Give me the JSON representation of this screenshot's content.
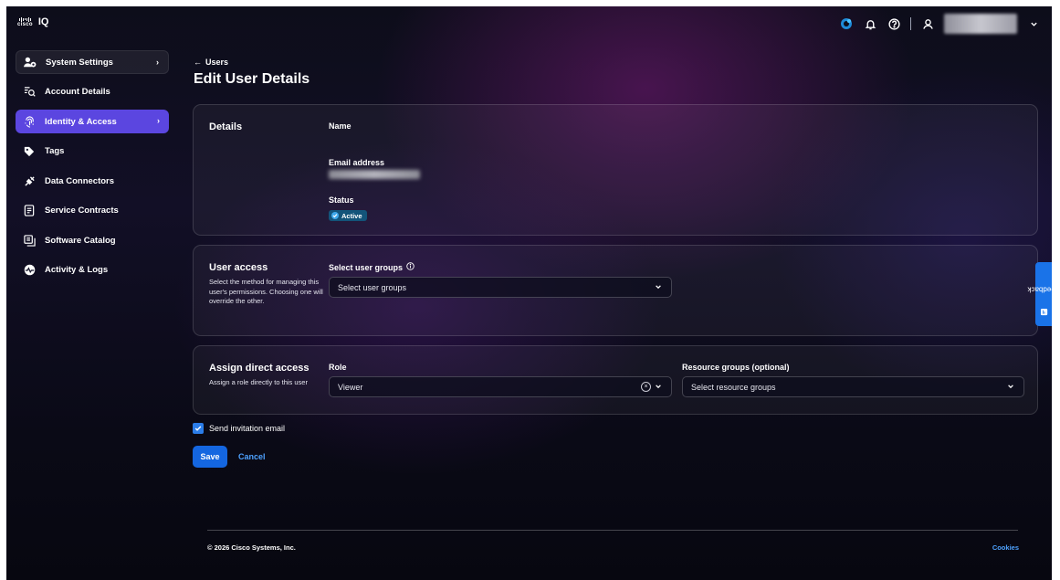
{
  "brand": {
    "name": "IQ",
    "wordmark": "cisco"
  },
  "topbar": {
    "icons": [
      "webex-icon",
      "bell-icon",
      "help-icon",
      "user-icon",
      "chevron-down-icon"
    ]
  },
  "sidebar": {
    "items": [
      {
        "label": "System Settings",
        "icon": "users-gear-icon"
      },
      {
        "label": "Account Details",
        "icon": "list-search-icon"
      },
      {
        "label": "Identity & Access",
        "icon": "fingerprint-icon",
        "active": true
      },
      {
        "label": "Tags",
        "icon": "tag-icon"
      },
      {
        "label": "Data Connectors",
        "icon": "plug-icon"
      },
      {
        "label": "Service Contracts",
        "icon": "contract-icon"
      },
      {
        "label": "Software Catalog",
        "icon": "catalog-icon"
      },
      {
        "label": "Activity & Logs",
        "icon": "activity-icon"
      }
    ]
  },
  "breadcrumb": {
    "arrow": "←",
    "label": "Users"
  },
  "page_title": "Edit User Details",
  "details": {
    "title": "Details",
    "name_label": "Name",
    "email_label": "Email address",
    "status_label": "Status",
    "status_value": "Active"
  },
  "user_access": {
    "title": "User access",
    "description": "Select the method for managing this user's permissions. Choosing one will override the other.",
    "groups_label": "Select user groups",
    "groups_placeholder": "Select user groups"
  },
  "direct_access": {
    "title": "Assign direct access",
    "description": "Assign a role directly to this user",
    "role_label": "Role",
    "role_value": "Viewer",
    "resource_label": "Resource groups (optional)",
    "resource_placeholder": "Select resource groups"
  },
  "invite": {
    "label": "Send invitation email",
    "checked": true
  },
  "actions": {
    "save": "Save",
    "cancel": "Cancel"
  },
  "footer": {
    "copyright": "© 2026 Cisco Systems, Inc.",
    "cookies": "Cookies"
  },
  "feedback": {
    "label": "Feedback"
  },
  "colors": {
    "accent": "#5b46e0",
    "primary_button": "#1466e0",
    "link": "#4ea2ff",
    "active_badge": "#13547a"
  }
}
